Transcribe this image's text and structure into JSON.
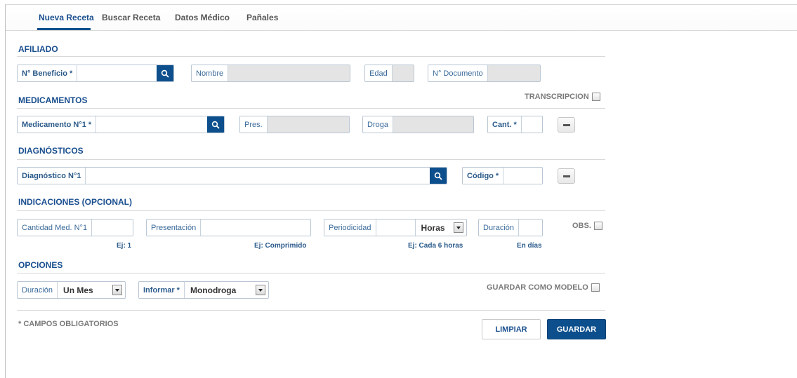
{
  "tabs": [
    {
      "label": "Nueva Receta",
      "active": true
    },
    {
      "label": "Buscar Receta",
      "active": false
    },
    {
      "label": "Datos Médico",
      "active": false
    },
    {
      "label": "Pañales",
      "active": false
    }
  ],
  "afiliado": {
    "title": "AFILIADO",
    "beneficio_label": "N° Beneficio *",
    "beneficio_value": "",
    "nombre_label": "Nombre",
    "edad_label": "Edad",
    "documento_label": "N° Documento"
  },
  "medicamentos": {
    "title": "MEDICAMENTOS",
    "transcripcion_label": "TRANSCRIPCION",
    "medicamento_label": "Medicamento N°1 *",
    "pres_label": "Pres.",
    "droga_label": "Droga",
    "cant_label": "Cant. *"
  },
  "diagnosticos": {
    "title": "DIAGNÓSTICOS",
    "diagnostico_label": "Diagnóstico N°1",
    "codigo_label": "Código *"
  },
  "indicaciones": {
    "title": "INDICACIONES (OPCIONAL)",
    "cantidad_label": "Cantidad Med. N°1",
    "cantidad_hint": "Ej: 1",
    "presentacion_label": "Presentación",
    "presentacion_hint": "Ej: Comprimido",
    "periodicidad_label": "Periodicidad",
    "periodicidad_unit": "Horas",
    "periodicidad_hint": "Ej: Cada 6 horas",
    "duracion_label": "Duración",
    "duracion_hint": "En días",
    "obs_label": "OBS."
  },
  "opciones": {
    "title": "OPCIONES",
    "duracion_label": "Duración",
    "duracion_value": "Un Mes",
    "informar_label": "Informar *",
    "informar_value": "Monodroga",
    "guardar_modelo_label": "GUARDAR COMO MODELO"
  },
  "footer": {
    "required_note": "* CAMPOS OBLIGATORIOS",
    "clear_label": "LIMPIAR",
    "save_label": "GUARDAR"
  },
  "colors": {
    "primary": "#0d4f8c",
    "label": "#3a6a9a",
    "section": "#1a4f8f"
  }
}
